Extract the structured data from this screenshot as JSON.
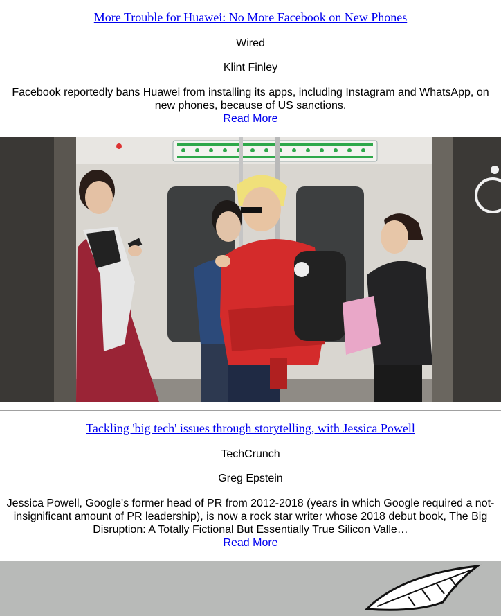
{
  "articles": [
    {
      "title": "More Trouble for Huawei: No More Facebook on New Phones",
      "source": "Wired",
      "author": "Klint Finley",
      "description": "Facebook reportedly bans Huawei from installing its apps, including Instagram and WhatsApp, on new phones, because of US sanctions.",
      "read_more": "Read More",
      "image": "subway-commuters-phones-photo"
    },
    {
      "title": "Tackling 'big tech' issues through storytelling, with Jessica Powell",
      "source": "TechCrunch",
      "author": "Greg Epstein",
      "description": "Jessica Powell, Google's former head of PR from 2012-2018 (years in which Google required a not-insignificant amount of PR leadership), is now a rock star writer whose 2018 debut book, The Big Disruption: A Totally Fictional But Essentially True Silicon Valle…",
      "read_more": "Read More",
      "image": "feather-illustration-photo"
    }
  ],
  "colors": {
    "link": "#0000ee",
    "divider": "#a0a0a0"
  }
}
